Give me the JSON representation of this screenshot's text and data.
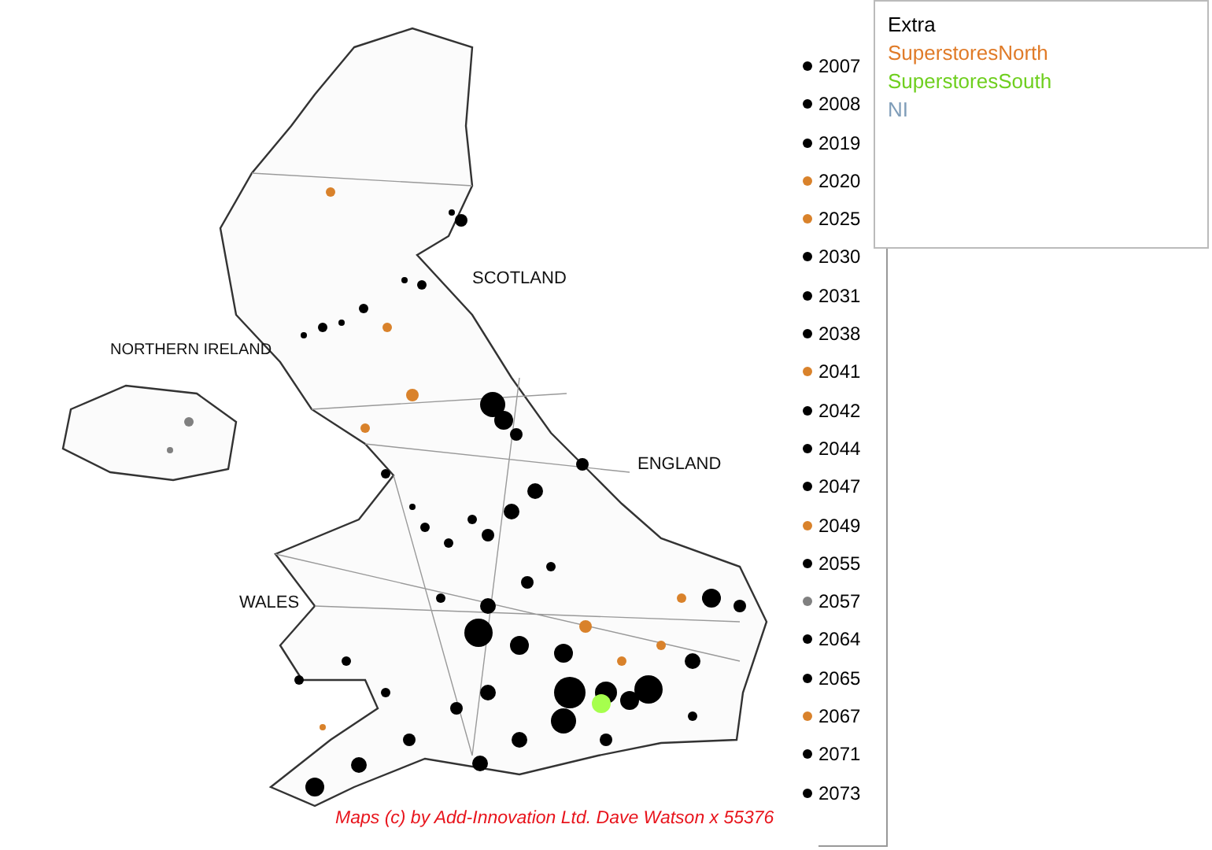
{
  "map_labels": [
    {
      "text": "SCOTLAND"
    },
    {
      "text": "NORTHERN IRELAND"
    },
    {
      "text": "ENGLAND"
    },
    {
      "text": "WALES"
    }
  ],
  "legend": [
    {
      "label": "2007",
      "color": "#000000"
    },
    {
      "label": "2008",
      "color": "#000000"
    },
    {
      "label": "2019",
      "color": "#000000"
    },
    {
      "label": "2020",
      "color": "#d9822b"
    },
    {
      "label": "2025",
      "color": "#d9822b"
    },
    {
      "label": "2030",
      "color": "#000000"
    },
    {
      "label": "2031",
      "color": "#000000"
    },
    {
      "label": "2038",
      "color": "#000000"
    },
    {
      "label": "2041",
      "color": "#d9822b"
    },
    {
      "label": "2042",
      "color": "#000000"
    },
    {
      "label": "2044",
      "color": "#000000"
    },
    {
      "label": "2047",
      "color": "#000000"
    },
    {
      "label": "2049",
      "color": "#d9822b"
    },
    {
      "label": "2055",
      "color": "#000000"
    },
    {
      "label": "2057",
      "color": "#808080"
    },
    {
      "label": "2064",
      "color": "#000000"
    },
    {
      "label": "2065",
      "color": "#000000"
    },
    {
      "label": "2067",
      "color": "#d9822b"
    },
    {
      "label": "2071",
      "color": "#000000"
    },
    {
      "label": "2073",
      "color": "#000000"
    }
  ],
  "extra_box": {
    "title": "Extra",
    "series": [
      {
        "label": "SuperstoresNorth",
        "color": "#e07b28"
      },
      {
        "label": "SuperstoresSouth",
        "color": "#6fcf1f"
      },
      {
        "label": "NI",
        "color": "#7f9db9"
      }
    ]
  },
  "credit": "Maps (c) by Add-Innovation Ltd.  Dave Watson x 55376"
}
